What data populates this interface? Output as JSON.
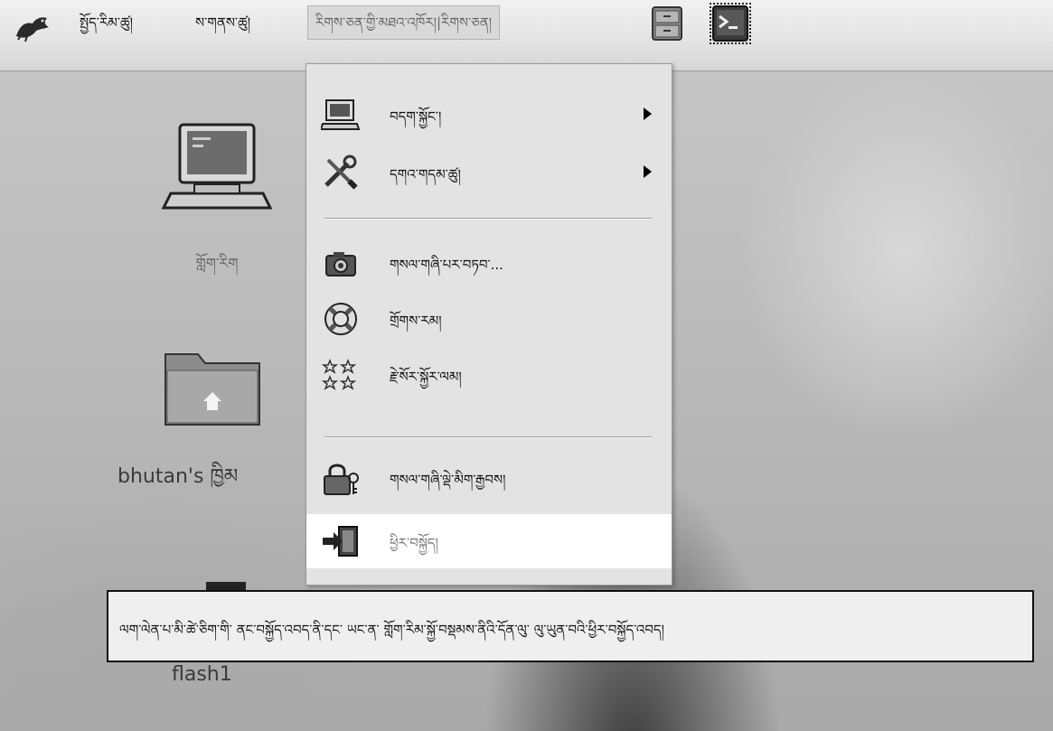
{
  "panel": {
    "menus": [
      {
        "label": "སྤྱོད་རིམ་ཚུ།"
      },
      {
        "label": "ས་གནས་ཚུ།"
      },
      {
        "label": "རིགས་ཅན་གྱི་མཐའ་འཁོར།|རིགས་ཅན།"
      }
    ],
    "launchers": [
      {
        "icon": "file-cabinet-icon"
      },
      {
        "icon": "terminal-icon"
      }
    ]
  },
  "desktop": {
    "icons": [
      {
        "icon": "computer-icon",
        "label": "གློག་རིག"
      },
      {
        "icon": "home-folder-icon",
        "label": "bhutan's ཁྱིམ"
      },
      {
        "icon": "drive-icon",
        "label": "flash1"
      }
    ]
  },
  "menu": {
    "items": [
      {
        "icon": "laptop-icon",
        "label": "བདག་སྐྱོང་།",
        "submenu": true
      },
      {
        "icon": "tools-icon",
        "label": "དགའ་གདམ་ཚུ།",
        "submenu": true
      },
      {
        "icon": "camera-icon",
        "label": "གསལ་གཞི་པར་བཏབ་...",
        "submenu": false
      },
      {
        "icon": "help-lifebuoy-icon",
        "label": "གྲོགས་རམ།",
        "submenu": false
      },
      {
        "icon": "stars-icon",
        "label": "རྗེ་སོར་སྐྱོར་ལམ།",
        "submenu": false
      },
      {
        "icon": "lock-screen-icon",
        "label": "གསལ་གཞི་ལྡེ་མིག་རྒྱབས།",
        "submenu": false
      },
      {
        "icon": "logout-icon",
        "label": "ཕྱིར་བསྐྱོད།",
        "submenu": false,
        "highlighted": true
      }
    ]
  },
  "tooltip": {
    "text": "ལག་ལེན་པ་མི་ཚེ་ཅིག་གི་ ནང་བསྐྱོད་འབད་ནི་དང་ ཡང་ན་ གློག་རིམ་སྐྱོ་བསྡམས་ནིའི་དོན་ལུ་ ལུ་ཡུན་བའི་ཕྱིར་བསྐྱོད་འབད།"
  },
  "colors": {
    "panel_bg": "#e3e3e3",
    "menu_bg": "#e3e3e3",
    "highlight_bg": "#ffffff",
    "tooltip_border": "#111111"
  }
}
